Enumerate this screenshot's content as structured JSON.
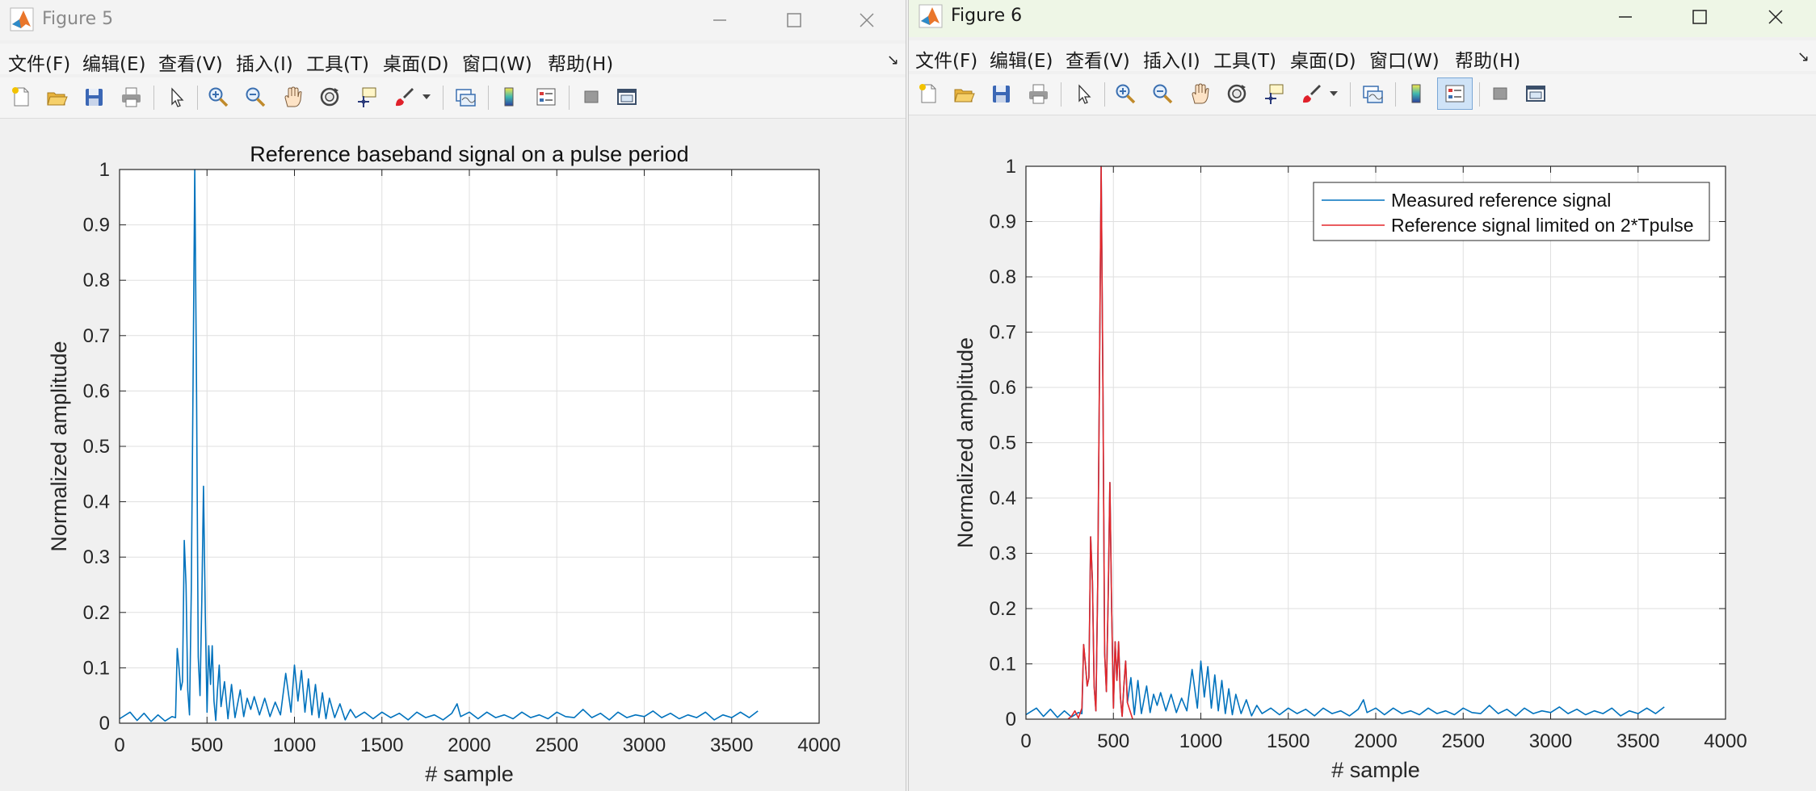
{
  "windows": [
    {
      "title": "Figure 5",
      "menu": [
        "文件(F)",
        "编辑(E)",
        "查看(V)",
        "插入(I)",
        "工具(T)",
        "桌面(D)",
        "窗口(W)",
        "帮助(H)"
      ],
      "toolbar_icons": [
        "new-figure-icon",
        "open-file-icon",
        "save-icon",
        "print-icon",
        "edit-plot-icon",
        "zoom-in-icon",
        "zoom-out-icon",
        "pan-icon",
        "rotate-3d-icon",
        "data-cursor-icon",
        "brush-icon",
        "brush-dropdown-icon",
        "link-plot-icon",
        "colorbar-icon",
        "legend-icon",
        "hide-plot-tools-icon",
        "show-plot-tools-icon"
      ]
    },
    {
      "title": "Figure 6",
      "menu": [
        "文件(F)",
        "编辑(E)",
        "查看(V)",
        "插入(I)",
        "工具(T)",
        "桌面(D)",
        "窗口(W)",
        "帮助(H)"
      ],
      "toolbar_icons": [
        "new-figure-icon",
        "open-file-icon",
        "save-icon",
        "print-icon",
        "edit-plot-icon",
        "zoom-in-icon",
        "zoom-out-icon",
        "pan-icon",
        "rotate-3d-icon",
        "data-cursor-icon",
        "brush-icon",
        "brush-dropdown-icon",
        "link-plot-icon",
        "colorbar-icon",
        "legend-icon",
        "hide-plot-tools-icon",
        "show-plot-tools-icon"
      ],
      "legend_button_pressed": true
    }
  ],
  "colors": {
    "measured": "#0072BD",
    "limited": "#E3262A",
    "matlab_logo": "#E9762B"
  },
  "chart_data": [
    {
      "type": "line",
      "title": "Reference baseband signal on a pulse period",
      "xlabel": "# sample",
      "ylabel": "Normalized amplitude",
      "xlim": [
        0,
        4000
      ],
      "ylim": [
        0,
        1
      ],
      "xticks": [
        "0",
        "500",
        "1000",
        "1500",
        "2000",
        "2500",
        "3000",
        "3500",
        "4000"
      ],
      "yticks": [
        "0",
        "0.1",
        "0.2",
        "0.3",
        "0.4",
        "0.5",
        "0.6",
        "0.7",
        "0.8",
        "0.9",
        "1"
      ],
      "grid": true,
      "legend": null,
      "series": [
        {
          "x": [
            0,
            60,
            100,
            140,
            180,
            220,
            260,
            300,
            320,
            330,
            340,
            350,
            360,
            370,
            380,
            390,
            400,
            410,
            420,
            430,
            440,
            450,
            460,
            470,
            480,
            490,
            500,
            510,
            520,
            530,
            540,
            550,
            560,
            570,
            580,
            600,
            620,
            640,
            660,
            690,
            710,
            730,
            750,
            770,
            800,
            830,
            860,
            890,
            920,
            950,
            980,
            1000,
            1020,
            1040,
            1060,
            1080,
            1100,
            1120,
            1140,
            1160,
            1180,
            1200,
            1230,
            1260,
            1290,
            1320,
            1350,
            1400,
            1450,
            1500,
            1550,
            1600,
            1650,
            1700,
            1750,
            1800,
            1850,
            1900,
            1930,
            1950,
            2000,
            2050,
            2100,
            2150,
            2200,
            2250,
            2300,
            2350,
            2400,
            2450,
            2500,
            2550,
            2600,
            2650,
            2700,
            2750,
            2800,
            2850,
            2900,
            2950,
            3000,
            3050,
            3100,
            3150,
            3200,
            3250,
            3300,
            3350,
            3400,
            3450,
            3500,
            3550,
            3600,
            3650
          ],
          "y": [
            0.008,
            0.02,
            0.005,
            0.018,
            0.003,
            0.015,
            0.004,
            0.012,
            0.01,
            0.135,
            0.1,
            0.06,
            0.075,
            0.33,
            0.25,
            0.06,
            0.015,
            0.24,
            0.6,
            1.0,
            0.6,
            0.12,
            0.05,
            0.22,
            0.428,
            0.2,
            0.02,
            0.14,
            0.07,
            0.14,
            0.04,
            0.005,
            0.06,
            0.105,
            0.03,
            0.075,
            0.008,
            0.07,
            0.01,
            0.06,
            0.012,
            0.045,
            0.025,
            0.048,
            0.015,
            0.045,
            0.012,
            0.038,
            0.015,
            0.09,
            0.02,
            0.105,
            0.04,
            0.095,
            0.02,
            0.08,
            0.015,
            0.07,
            0.01,
            0.055,
            0.008,
            0.045,
            0.01,
            0.035,
            0.006,
            0.025,
            0.01,
            0.02,
            0.008,
            0.02,
            0.01,
            0.018,
            0.006,
            0.02,
            0.01,
            0.015,
            0.006,
            0.018,
            0.035,
            0.012,
            0.02,
            0.008,
            0.02,
            0.01,
            0.015,
            0.008,
            0.02,
            0.01,
            0.015,
            0.008,
            0.02,
            0.012,
            0.01,
            0.025,
            0.01,
            0.018,
            0.006,
            0.02,
            0.01,
            0.015,
            0.012,
            0.022,
            0.01,
            0.018,
            0.008,
            0.015,
            0.01,
            0.02,
            0.006,
            0.015,
            0.01,
            0.02,
            0.01,
            0.022
          ]
        }
      ]
    },
    {
      "type": "line",
      "title": "",
      "xlabel": "# sample",
      "ylabel": "Normalized amplitude",
      "xlim": [
        0,
        4000
      ],
      "ylim": [
        0,
        1
      ],
      "xticks": [
        "0",
        "500",
        "1000",
        "1500",
        "2000",
        "2500",
        "3000",
        "3500",
        "4000"
      ],
      "yticks": [
        "0",
        "0.1",
        "0.2",
        "0.3",
        "0.4",
        "0.5",
        "0.6",
        "0.7",
        "0.8",
        "0.9",
        "1"
      ],
      "grid": true,
      "legend": "top-right",
      "series": [
        {
          "name": "Measured reference signal",
          "x": [
            0,
            60,
            100,
            140,
            180,
            220,
            260,
            300,
            320,
            330,
            340,
            350,
            360,
            370,
            380,
            390,
            400,
            410,
            420,
            430,
            440,
            450,
            460,
            470,
            480,
            490,
            500,
            510,
            520,
            530,
            540,
            550,
            560,
            570,
            580,
            600,
            620,
            640,
            660,
            690,
            710,
            730,
            750,
            770,
            800,
            830,
            860,
            890,
            920,
            950,
            980,
            1000,
            1020,
            1040,
            1060,
            1080,
            1100,
            1120,
            1140,
            1160,
            1180,
            1200,
            1230,
            1260,
            1290,
            1320,
            1350,
            1400,
            1450,
            1500,
            1550,
            1600,
            1650,
            1700,
            1750,
            1800,
            1850,
            1900,
            1930,
            1950,
            2000,
            2050,
            2100,
            2150,
            2200,
            2250,
            2300,
            2350,
            2400,
            2450,
            2500,
            2550,
            2600,
            2650,
            2700,
            2750,
            2800,
            2850,
            2900,
            2950,
            3000,
            3050,
            3100,
            3150,
            3200,
            3250,
            3300,
            3350,
            3400,
            3450,
            3500,
            3550,
            3600,
            3650
          ],
          "y": [
            0.008,
            0.02,
            0.005,
            0.018,
            0.003,
            0.015,
            0.004,
            0.012,
            0.01,
            0.135,
            0.1,
            0.06,
            0.075,
            0.33,
            0.25,
            0.06,
            0.015,
            0.24,
            0.6,
            1.0,
            0.6,
            0.12,
            0.05,
            0.22,
            0.428,
            0.2,
            0.02,
            0.14,
            0.07,
            0.14,
            0.04,
            0.005,
            0.06,
            0.105,
            0.03,
            0.075,
            0.008,
            0.07,
            0.01,
            0.06,
            0.012,
            0.045,
            0.025,
            0.048,
            0.015,
            0.045,
            0.012,
            0.038,
            0.015,
            0.09,
            0.02,
            0.105,
            0.04,
            0.095,
            0.02,
            0.08,
            0.015,
            0.07,
            0.01,
            0.055,
            0.008,
            0.045,
            0.01,
            0.035,
            0.006,
            0.025,
            0.01,
            0.02,
            0.008,
            0.02,
            0.01,
            0.018,
            0.006,
            0.02,
            0.01,
            0.015,
            0.006,
            0.018,
            0.035,
            0.012,
            0.02,
            0.008,
            0.02,
            0.01,
            0.015,
            0.008,
            0.02,
            0.01,
            0.015,
            0.008,
            0.02,
            0.012,
            0.01,
            0.025,
            0.01,
            0.018,
            0.006,
            0.02,
            0.01,
            0.015,
            0.012,
            0.022,
            0.01,
            0.018,
            0.008,
            0.015,
            0.01,
            0.02,
            0.006,
            0.015,
            0.01,
            0.02,
            0.01,
            0.022
          ]
        },
        {
          "name": "Reference signal limited on 2*Tpulse",
          "x": [
            240,
            260,
            280,
            300,
            320,
            330,
            340,
            350,
            360,
            370,
            380,
            390,
            400,
            410,
            420,
            430,
            440,
            450,
            460,
            470,
            480,
            490,
            500,
            510,
            520,
            530,
            540,
            550,
            560,
            570,
            580,
            600,
            610
          ],
          "y": [
            0.0,
            0.005,
            0.015,
            0.002,
            0.02,
            0.135,
            0.1,
            0.06,
            0.075,
            0.33,
            0.25,
            0.06,
            0.015,
            0.24,
            0.6,
            1.0,
            0.6,
            0.12,
            0.05,
            0.22,
            0.428,
            0.2,
            0.02,
            0.14,
            0.07,
            0.14,
            0.04,
            0.005,
            0.06,
            0.105,
            0.03,
            0.01,
            0.0
          ]
        }
      ]
    }
  ]
}
